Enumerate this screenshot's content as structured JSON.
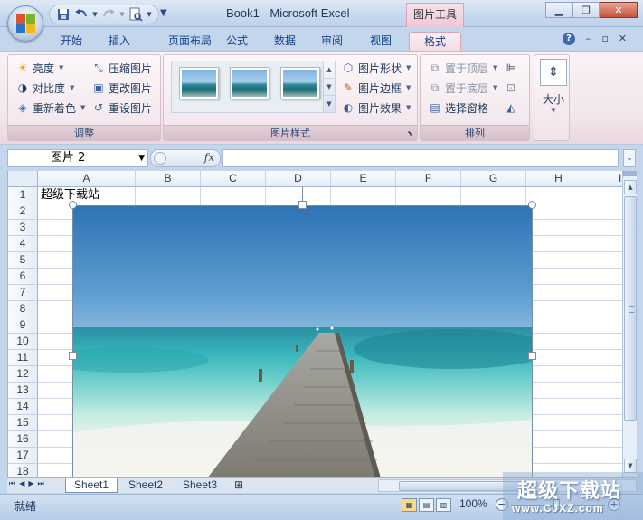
{
  "window": {
    "title": "Book1 - Microsoft Excel",
    "context_tool": "图片工具",
    "accent_color": "#c4d6ec",
    "context_color": "#eec9d6"
  },
  "quick_access": [
    "save-icon",
    "undo-icon",
    "redo-icon",
    "print-preview-icon"
  ],
  "tabs": [
    {
      "label": "开始",
      "active": false
    },
    {
      "label": "插入",
      "active": false
    },
    {
      "label": "页面布局",
      "active": false
    },
    {
      "label": "公式",
      "active": false
    },
    {
      "label": "数据",
      "active": false
    },
    {
      "label": "审阅",
      "active": false
    },
    {
      "label": "视图",
      "active": false
    },
    {
      "label": "格式",
      "active": true
    }
  ],
  "ribbon": {
    "adjust": {
      "label": "调整",
      "items": [
        {
          "label": "亮度",
          "icon": "sun-icon",
          "dropdown": true
        },
        {
          "label": "对比度",
          "icon": "contrast-icon",
          "dropdown": true
        },
        {
          "label": "重新着色",
          "icon": "recolor-icon",
          "dropdown": true
        },
        {
          "label": "压缩图片",
          "icon": "compress-icon"
        },
        {
          "label": "更改图片",
          "icon": "change-picture-icon"
        },
        {
          "label": "重设图片",
          "icon": "reset-picture-icon"
        }
      ]
    },
    "styles": {
      "label": "图片样式",
      "items": [
        {
          "label": "图片形状",
          "icon": "shape-icon",
          "dropdown": true
        },
        {
          "label": "图片边框",
          "icon": "border-icon",
          "dropdown": true
        },
        {
          "label": "图片效果",
          "icon": "effects-icon",
          "dropdown": true
        }
      ]
    },
    "arrange": {
      "label": "排列",
      "items": [
        {
          "label": "置于顶层",
          "dim": true,
          "dropdown": true
        },
        {
          "label": "置于底层",
          "dim": true,
          "dropdown": true
        },
        {
          "label": "选择窗格",
          "dim": false
        }
      ]
    },
    "size": {
      "label": "大小"
    }
  },
  "formula_bar": {
    "name_box": "图片 2",
    "fx_label": "fx",
    "formula": ""
  },
  "grid": {
    "columns": [
      "A",
      "B",
      "C",
      "D",
      "E",
      "F",
      "G",
      "H",
      "I"
    ],
    "rows": [
      "1",
      "2",
      "3",
      "4",
      "5",
      "6",
      "7",
      "8",
      "9",
      "10",
      "11",
      "12",
      "13",
      "14",
      "15",
      "16",
      "17",
      "18"
    ],
    "cell_a1": "超级下载站"
  },
  "sheets": [
    {
      "label": "Sheet1",
      "active": true
    },
    {
      "label": "Sheet2",
      "active": false
    },
    {
      "label": "Sheet3",
      "active": false
    }
  ],
  "status": {
    "ready": "就绪",
    "zoom": "100%"
  },
  "watermark": {
    "main": "超级下载站",
    "url": "www.CJXZ.com"
  }
}
